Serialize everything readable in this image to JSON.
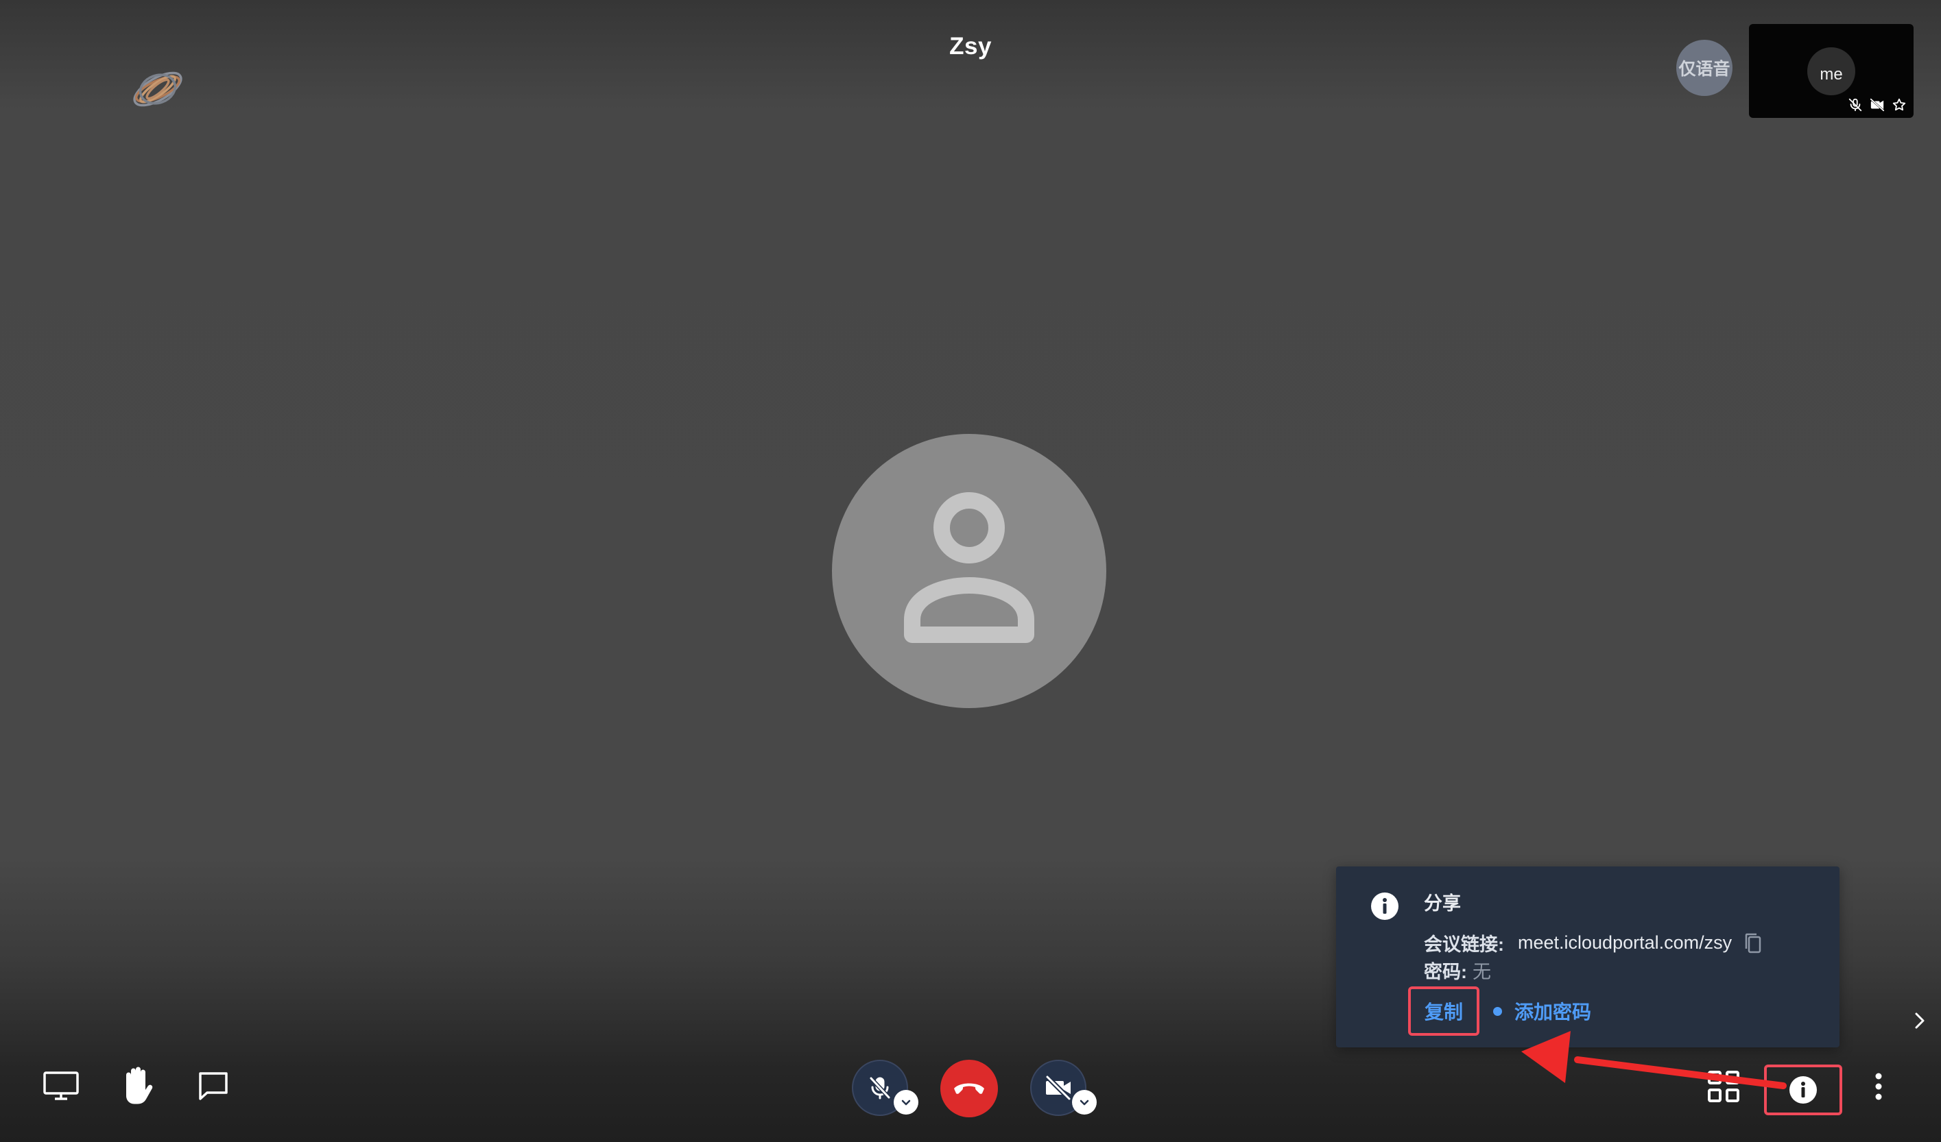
{
  "meeting": {
    "title": "Zsy"
  },
  "topbar": {
    "audio_only_label": "仅语音",
    "self_label": "me"
  },
  "share_popup": {
    "heading": "分享",
    "link_label": "会议链接:",
    "link_value": "meet.icloudportal.com/zsy",
    "password_label": "密码:",
    "password_value": "无",
    "copy_label": "复制",
    "add_password_label": "添加密码"
  },
  "icons": {
    "logo": "swirl-logo-icon",
    "share_screen": "monitor-icon",
    "raise_hand": "hand-icon",
    "chat": "chat-bubble-icon",
    "mic": "mic-off-icon",
    "hangup": "phone-hangup-icon",
    "camera": "camera-off-icon",
    "tile_view": "grid-icon",
    "info": "info-icon",
    "more": "more-vertical-icon",
    "copy": "copy-icon",
    "next": "chevron-right-icon"
  },
  "colors": {
    "accent_link": "#4f9cf7",
    "hangup_red": "#dd2b2b",
    "highlight_red": "#f04a5a",
    "popup_bg": "#263040"
  }
}
